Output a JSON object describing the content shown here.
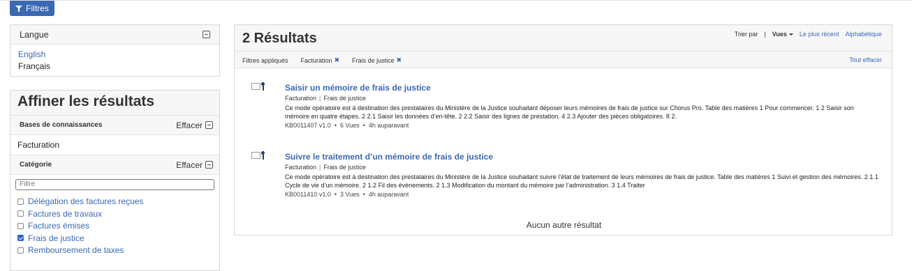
{
  "toolbar": {
    "filters_label": "Filtres"
  },
  "language_panel": {
    "title": "Langue",
    "options": [
      {
        "label": "English",
        "active": false
      },
      {
        "label": "Français",
        "active": true
      }
    ]
  },
  "refine_panel": {
    "title": "Affiner les résultats",
    "knowledge_bases": {
      "label": "Bases de connaissances",
      "clear_label": "Effacer",
      "value": "Facturation"
    },
    "category": {
      "label": "Catégorie",
      "clear_label": "Effacer",
      "filter_placeholder": "Filtre",
      "items": [
        {
          "label": "Délégation des factures reçues",
          "checked": false
        },
        {
          "label": "Factures de travaux",
          "checked": false
        },
        {
          "label": "Factures émises",
          "checked": false
        },
        {
          "label": "Frais de justice",
          "checked": true
        },
        {
          "label": "Remboursement de taxes",
          "checked": false
        }
      ]
    }
  },
  "results": {
    "count_label": "2 Résultats",
    "sort": {
      "label": "Trier par",
      "separator": "|",
      "options": [
        "Vues",
        "Le plus récent",
        "Alphabétique"
      ],
      "selected": "Vues"
    },
    "applied_filters": {
      "label": "Filtres appliqués",
      "tags": [
        "Facturation",
        "Frais de justice"
      ],
      "remove_icon": "✖",
      "clear_all": "Tout effacer"
    },
    "items": [
      {
        "title": "Saisir un mémoire de frais de justice",
        "category": "Facturation",
        "subcategory": "Frais de justice",
        "description": "Ce mode opératoire est à destination des prestataires du Ministère de la Justice souhaitant déposer leurs mémoires de frais de justice sur Chorus Pro. Table des matières 1 Pour commencer. 1 2 Saisir son mémoire en quatre étapes. 2 2.1 Saisir les données d’en-tête. 2 2.2 Saisir des lignes de prestation. 4 2.3 Ajouter des pièces obligatoires. 8 2.",
        "article_id": "KB0011407 v1.0",
        "views": "6 Vues",
        "age": "4h auparavant"
      },
      {
        "title": "Suivre le traitement d’un mémoire de frais de justice",
        "category": "Facturation",
        "subcategory": "Frais de justice",
        "description": "Ce mode opératoire est à destination des prestataires du Ministère de la Justice souhaitant suivre l’état de traitement de leurs mémoires de frais de justice. Table des matières 1 Suivi et gestion des mémoires. 2 1.1 Cycle de vie d’un mémoire. 2 1.2 Fil des évènements. 2 1.3 Modification du montant du mémoire par l’administration. 3 1.4 Traiter",
        "article_id": "KB0011410 v1.0",
        "views": "3 Vues",
        "age": "4h auparavant"
      }
    ],
    "no_more_label": "Aucun autre résultat",
    "meta_separator": "•"
  }
}
